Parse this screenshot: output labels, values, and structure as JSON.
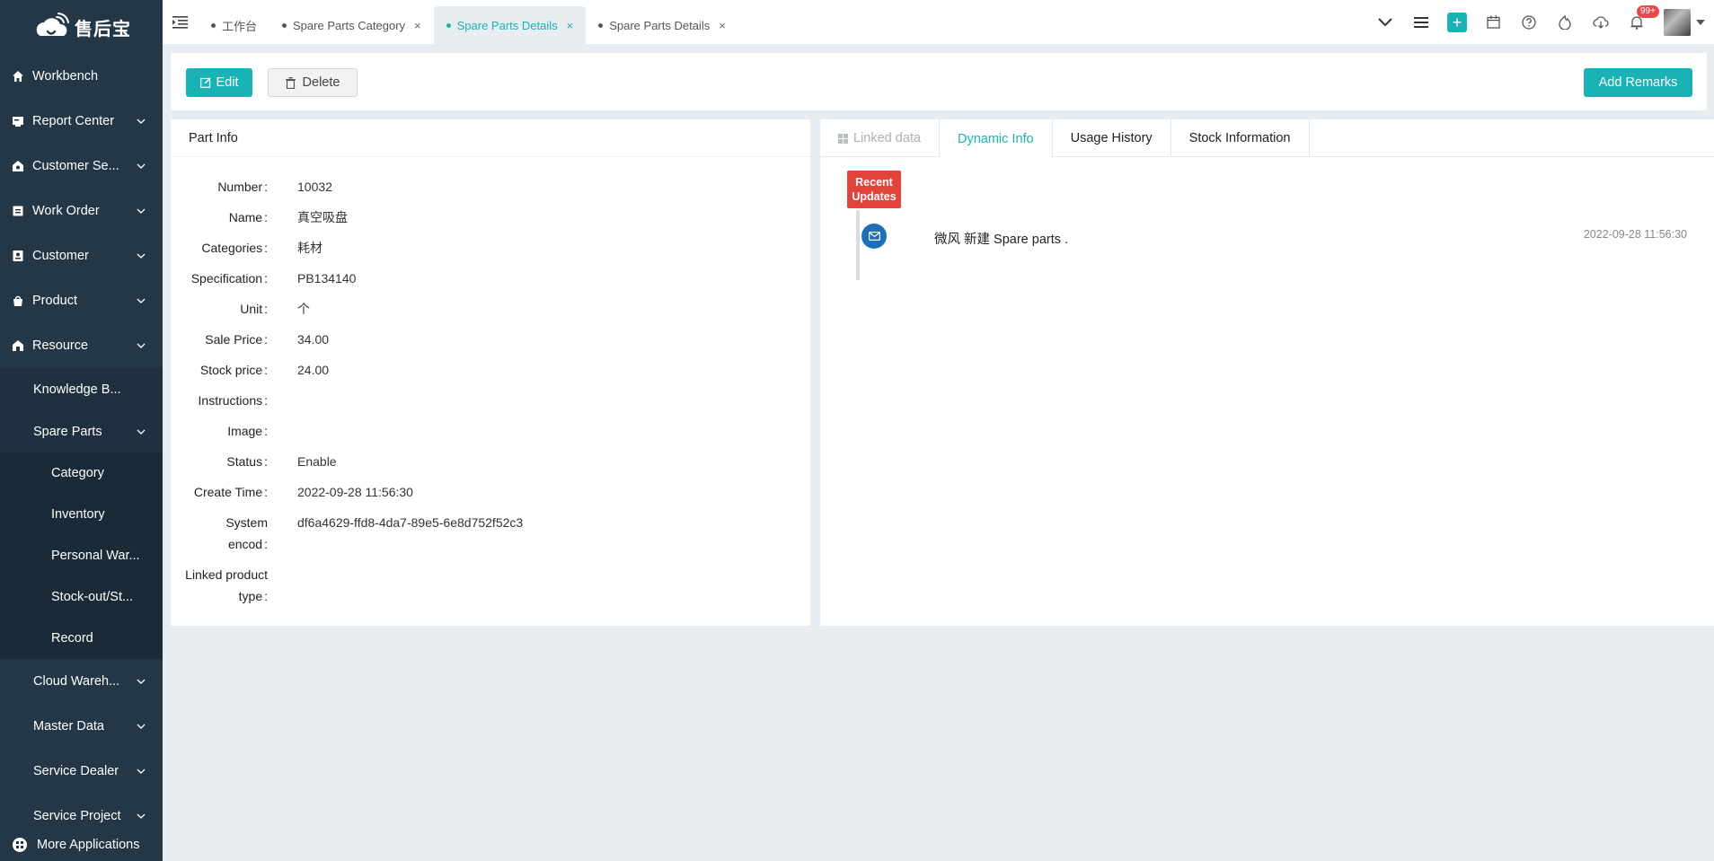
{
  "brand": {
    "name": "售后宝"
  },
  "sidebar": {
    "items": [
      {
        "label": "Workbench",
        "icon": "home-icon",
        "has_children": false
      },
      {
        "label": "Report Center",
        "icon": "report-icon",
        "has_children": true
      },
      {
        "label": "Customer Se...",
        "icon": "customer-service-icon",
        "has_children": true
      },
      {
        "label": "Work Order",
        "icon": "work-order-icon",
        "has_children": true
      },
      {
        "label": "Customer",
        "icon": "customer-icon",
        "has_children": true
      },
      {
        "label": "Product",
        "icon": "product-icon",
        "has_children": true
      },
      {
        "label": "Resource",
        "icon": "resource-icon",
        "has_children": true
      }
    ],
    "resource_children": [
      {
        "label": "Knowledge B..."
      },
      {
        "label": "Spare Parts"
      }
    ],
    "spare_parts_children": [
      {
        "label": "Category"
      },
      {
        "label": "Inventory"
      },
      {
        "label": "Personal War..."
      },
      {
        "label": "Stock-out/St..."
      },
      {
        "label": "Record"
      }
    ],
    "items_after": [
      {
        "label": "Cloud Wareh..."
      },
      {
        "label": "Master Data"
      },
      {
        "label": "Service Dealer"
      },
      {
        "label": "Service Project"
      }
    ],
    "more_apps": "More Applications"
  },
  "topbar": {
    "tabs": [
      {
        "label": "工作台",
        "closable": false,
        "active": false
      },
      {
        "label": "Spare Parts Category",
        "closable": true,
        "active": false
      },
      {
        "label": "Spare Parts Details",
        "closable": true,
        "active": true
      },
      {
        "label": "Spare Parts Details",
        "closable": true,
        "active": false
      }
    ],
    "close_glyph": "×",
    "notification_badge": "99+"
  },
  "toolbar": {
    "edit_label": "Edit",
    "delete_label": "Delete",
    "add_remarks_label": "Add Remarks"
  },
  "part_info": {
    "title": "Part Info",
    "fields": [
      {
        "key": "Number",
        "value": "10032"
      },
      {
        "key": "Name",
        "value": "真空吸盘"
      },
      {
        "key": "Categories",
        "value": "耗材"
      },
      {
        "key": "Specification",
        "value": "PB134140"
      },
      {
        "key": "Unit",
        "value": "个"
      },
      {
        "key": "Sale Price",
        "value": "34.00"
      },
      {
        "key": "Stock price",
        "value": "24.00"
      },
      {
        "key": "Instructions",
        "value": ""
      },
      {
        "key": "Image",
        "value": ""
      },
      {
        "key": "Status",
        "value": "Enable"
      },
      {
        "key": "Create Time",
        "value": "2022-09-28 11:56:30"
      },
      {
        "key_line1": "System",
        "key_line2": "encod",
        "value": "df6a4629-ffd8-4da7-89e5-6e8d752f52c3"
      },
      {
        "key_line1": "Linked product",
        "key_line2": "type",
        "value": ""
      }
    ],
    "colon": ":"
  },
  "dynamic": {
    "tabs": [
      {
        "label": "Linked data",
        "disabled": true
      },
      {
        "label": "Dynamic Info",
        "active": true
      },
      {
        "label": "Usage History"
      },
      {
        "label": "Stock Information"
      }
    ],
    "recent_tag_line1": "Recent",
    "recent_tag_line2": "Updates",
    "entries": [
      {
        "text": "微风 新建 Spare parts .",
        "time": "2022-09-28 11:56:30",
        "icon": "mail-icon"
      }
    ]
  },
  "colors": {
    "accent": "#1ab3b5",
    "sidebar_bg": "#233746",
    "danger": "#e2433a",
    "timeline_dot": "#1d6fb8"
  }
}
